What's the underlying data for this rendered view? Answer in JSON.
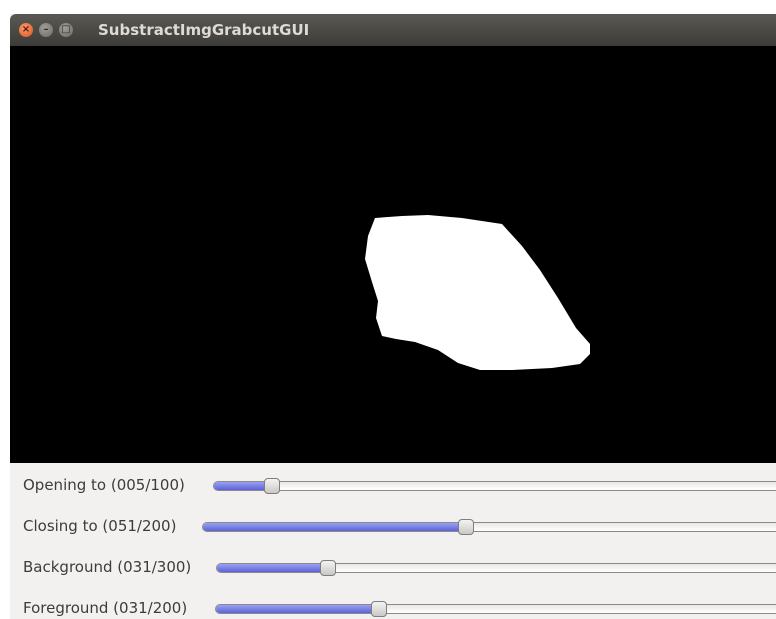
{
  "window": {
    "title": "SubstractImgGrabcutGUI",
    "close_glyph": "×",
    "minimize_glyph": "–",
    "maximize_glyph": "□",
    "close_icon": "close-icon",
    "minimize_icon": "minimize-icon",
    "maximize_icon": "maximize-icon"
  },
  "image": {
    "background_color": "#000000",
    "mask_color": "#ffffff"
  },
  "sliders": [
    {
      "label": "Opening to (005/100)",
      "value": 5,
      "max": 100
    },
    {
      "label": "Closing to (051/200)",
      "value": 51,
      "max": 200
    },
    {
      "label": "Background (031/300)",
      "value": 31,
      "max": 300
    },
    {
      "label": "Foreground (031/200)",
      "value": 31,
      "max": 200
    }
  ],
  "colors": {
    "titlebar": "#3c3b37",
    "close_button": "#e0541f",
    "slider_fill": "#5c63d8",
    "panel": "#f2f1f0"
  }
}
